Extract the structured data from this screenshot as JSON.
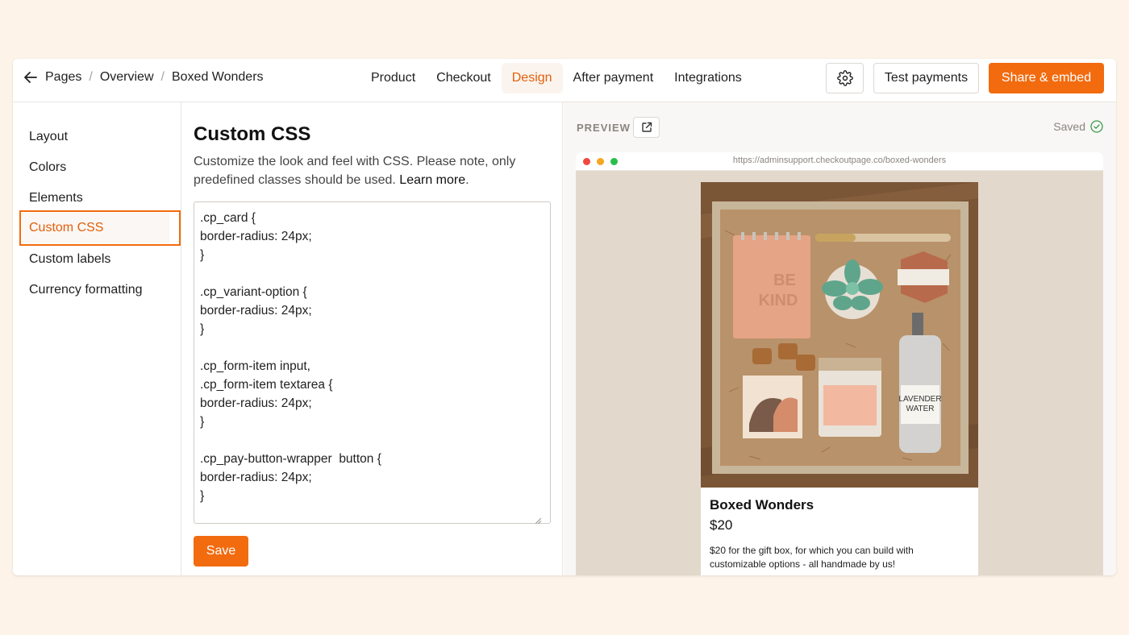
{
  "breadcrumb": [
    "Pages",
    "Overview",
    "Boxed Wonders"
  ],
  "tabs": [
    {
      "label": "Product",
      "active": false
    },
    {
      "label": "Checkout",
      "active": false
    },
    {
      "label": "Design",
      "active": true
    },
    {
      "label": "After payment",
      "active": false
    },
    {
      "label": "Integrations",
      "active": false
    }
  ],
  "toolbar": {
    "test_label": "Test payments",
    "share_label": "Share & embed"
  },
  "sidebar": {
    "items": [
      "Layout",
      "Colors",
      "Elements",
      "Custom CSS",
      "Custom labels",
      "Currency formatting"
    ],
    "active": "Custom CSS"
  },
  "editor": {
    "title": "Custom CSS",
    "description": "Customize the look and feel with CSS. Please note, only predefined classes should be used.",
    "learn_more": "Learn more",
    "code": ".cp_card {\nborder-radius: 24px;\n}\n\n.cp_variant-option {\nborder-radius: 24px;\n}\n\n.cp_form-item input,\n.cp_form-item textarea {\nborder-radius: 24px;\n}\n\n.cp_pay-button-wrapper  button {\nborder-radius: 24px;\n}",
    "save_label": "Save"
  },
  "preview": {
    "label": "PREVIEW",
    "status": "Saved",
    "url": "https://adminsupport.checkoutpage.co/boxed-wonders",
    "product_name": "Boxed Wonders",
    "price": "$20",
    "description": "$20 for the gift box, for which you can build with customizable options - all handmade by us!",
    "photo_text": {
      "notepad": "BE KIND",
      "bottle": "LAVENDER WATER"
    }
  },
  "colors": {
    "accent": "#f26b0f",
    "accent_text": "#e35f0b",
    "page_bg": "#fdf3e9",
    "preview_bg": "#e3d8cc"
  }
}
